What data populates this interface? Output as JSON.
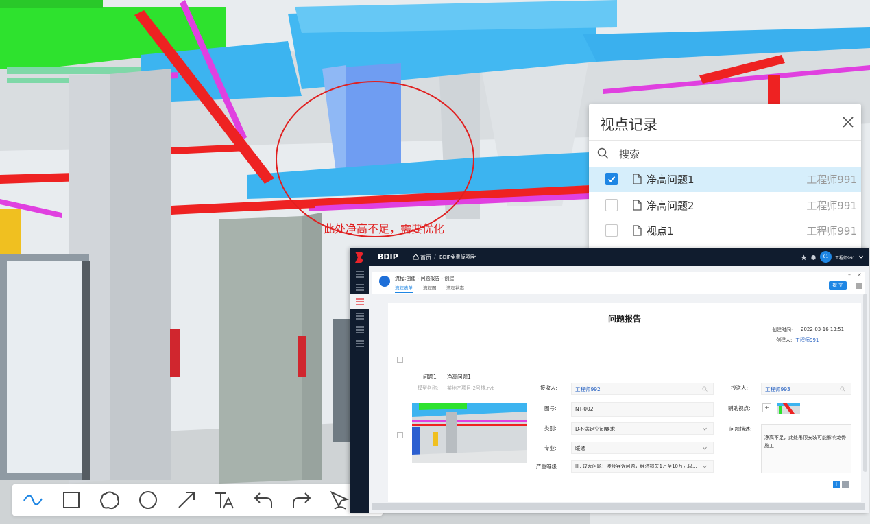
{
  "annotation": {
    "text": "此处净高不足，需要优化"
  },
  "viewpoint_panel": {
    "title": "视点记录",
    "search_placeholder": "搜索",
    "items": [
      {
        "name": "净高问题1",
        "user": "工程师991",
        "checked": true
      },
      {
        "name": "净高问题2",
        "user": "工程师991",
        "checked": false
      },
      {
        "name": "视点1",
        "user": "工程师991",
        "checked": false
      }
    ]
  },
  "toolbar": {
    "tools": [
      "curve-icon",
      "rectangle-icon",
      "cloud-icon",
      "circle-icon",
      "arrow-icon",
      "text-icon",
      "undo-icon",
      "redo-icon",
      "pen-icon"
    ]
  },
  "app": {
    "brand": "BDIP",
    "breadcrumb_home": "首页",
    "breadcrumb_project": "BDIP免费版项目",
    "user_avatar": "91",
    "user_name": "工程师991",
    "workflow_title": "流程:创建 - 问题报告 - 创建",
    "tabs": [
      "流程表单",
      "流程图",
      "流程状态"
    ],
    "submit_label": "提 交",
    "form": {
      "title": "问题报告",
      "created_time_label": "创建时间:",
      "created_time": "2022-03-16 13:51",
      "creator_label": "创建人:",
      "creator": "工程师991",
      "issue_no": "问题1",
      "issue_name": "净高问题1",
      "model_label": "模型名称:",
      "model_value": "某地产项目-2号楼.rvt",
      "receiver_label": "接收人:",
      "receiver": "工程师992",
      "cc_label": "抄送人:",
      "cc": "工程师993",
      "drawing_label": "图号:",
      "drawing": "NT-002",
      "aux_view_label": "辅助视点:",
      "category_label": "类别:",
      "category": "D不满足空间要求",
      "desc_label": "问题描述:",
      "desc": "净高不足，此处吊顶安装可能影响龙骨施工",
      "discipline_label": "专业:",
      "discipline": "暖通",
      "severity_label": "严重等级:",
      "severity": "III. 较大问题：涉及客诉问题，经济损失1万至10万元以..."
    }
  },
  "colors": {
    "accent": "#1e86e4",
    "annotation": "#e02020",
    "nav": "#101c2e"
  }
}
